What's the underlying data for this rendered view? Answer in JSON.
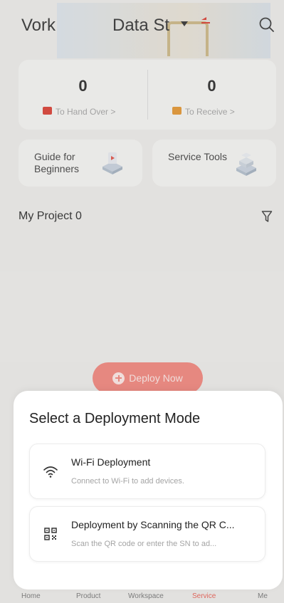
{
  "header": {
    "tabs": [
      {
        "label": "Vork"
      },
      {
        "label": "Data St"
      }
    ]
  },
  "stats": {
    "hand_over": {
      "count": "0",
      "label": "To Hand Over >"
    },
    "receive": {
      "count": "0",
      "label": "To Receive >"
    }
  },
  "tiles": [
    {
      "label": "Guide for Beginners"
    },
    {
      "label": "Service Tools"
    }
  ],
  "project": {
    "title": "My Project 0",
    "deploy_button": "Deploy Now"
  },
  "sheet": {
    "title": "Select a Deployment Mode",
    "options": [
      {
        "title": "Wi-Fi Deployment",
        "subtitle": "Connect to Wi-Fi to add devices.",
        "icon": "wifi-icon"
      },
      {
        "title": "Deployment by Scanning the QR C...",
        "subtitle": "Scan the QR code or enter the SN to ad...",
        "icon": "qr-code-icon"
      }
    ]
  },
  "bottom_nav": {
    "items": [
      {
        "label": "Home"
      },
      {
        "label": "Product"
      },
      {
        "label": "Workspace"
      },
      {
        "label": "Service"
      },
      {
        "label": "Me"
      }
    ],
    "active": "Service"
  },
  "colors": {
    "accent": "#e8675c",
    "deploy_button": "#f08a82",
    "sheet_bg": "#ffffff",
    "page_bg": "#ecebe9"
  }
}
